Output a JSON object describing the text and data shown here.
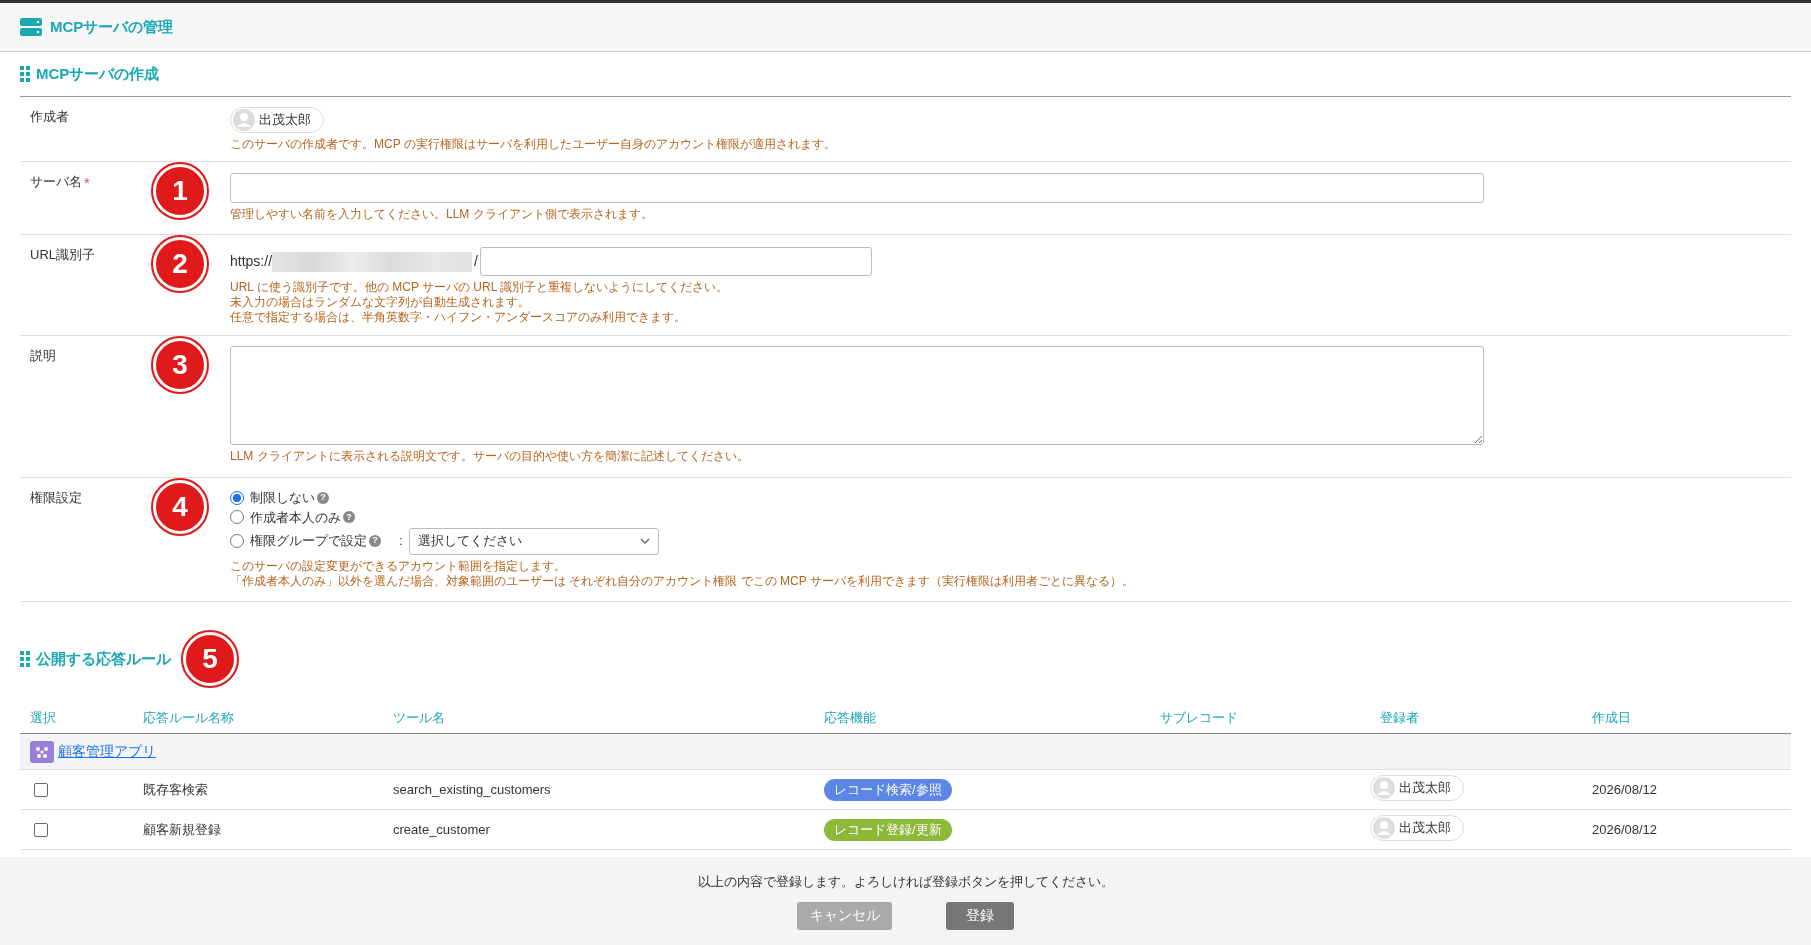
{
  "header": {
    "title": "MCPサーバの管理"
  },
  "form_section": {
    "title": "MCPサーバの作成"
  },
  "fields": [
    {
      "kind": "creator",
      "label": "作成者",
      "user": "出茂太郎",
      "hints": [
        "このサーバの作成者です。MCP の実行権限はサーバを利用したユーザー自身のアカウント権限が適用されます。"
      ]
    },
    {
      "kind": "text",
      "label": "サーバ名",
      "required_mark": "*",
      "callout": "1",
      "hints": [
        "管理しやすい名前を入力してください。LLM クライアント側で表示されます。"
      ]
    },
    {
      "kind": "url",
      "label": "URL識別子",
      "callout": "2",
      "prefix": "https://",
      "suffix": "/",
      "hints": [
        "URL に使う識別子です。他の MCP サーバの URL 識別子と重複しないようにしてください。",
        "未入力の場合はランダムな文字列が自動生成されます。",
        "任意で指定する場合は、半角英数字・ハイフン・アンダースコアのみ利用できます。"
      ]
    },
    {
      "kind": "textarea",
      "label": "説明",
      "callout": "3",
      "hints": [
        "LLM クライアントに表示される説明文です。サーバの目的や使い方を簡潔に記述してください。"
      ]
    },
    {
      "kind": "radio",
      "label": "権限設定",
      "callout": "4",
      "options": [
        {
          "label": "制限しない",
          "selected": true,
          "help": "?"
        },
        {
          "label": "作成者本人のみ",
          "selected": false,
          "help": "?"
        },
        {
          "label": "権限グループで設定",
          "selected": false,
          "help": "?",
          "separator": ":",
          "dropdown": "選択してください"
        }
      ],
      "hints": [
        "このサーバの設定変更ができるアカウント範囲を指定します。",
        "「作成者本人のみ」以外を選んだ場合、対象範囲のユーザーは それぞれ自分のアカウント権限 でこの MCP サーバを利用できます（実行権限は利用者ごとに異なる）。"
      ]
    }
  ],
  "rules_section": {
    "title": "公開する応答ルール",
    "callout": "5"
  },
  "table": {
    "columns": [
      "選択",
      "応答ルール名称",
      "ツール名",
      "応答機能",
      "サブレコード",
      "登録者",
      "作成日"
    ],
    "group": "顧客管理アプリ",
    "rows": [
      {
        "checked": false,
        "name": "既存客検索",
        "tool": "search_existing_customers",
        "function": "レコード検索/参照",
        "color": "#5b86e5",
        "user": "出茂太郎",
        "date": "2026/08/12"
      },
      {
        "checked": false,
        "name": "顧客新規登録",
        "tool": "create_customer",
        "function": "レコード登録/更新",
        "color": "#8db83a",
        "user": "出茂太郎",
        "date": "2026/08/12"
      }
    ]
  },
  "footer": {
    "message": "以上の内容で登録します。よろしければ登録ボタンを押してください。",
    "buttons": [
      {
        "kind": "cancel",
        "label": "キャンセル"
      },
      {
        "kind": "submit",
        "label": "登録"
      }
    ]
  }
}
